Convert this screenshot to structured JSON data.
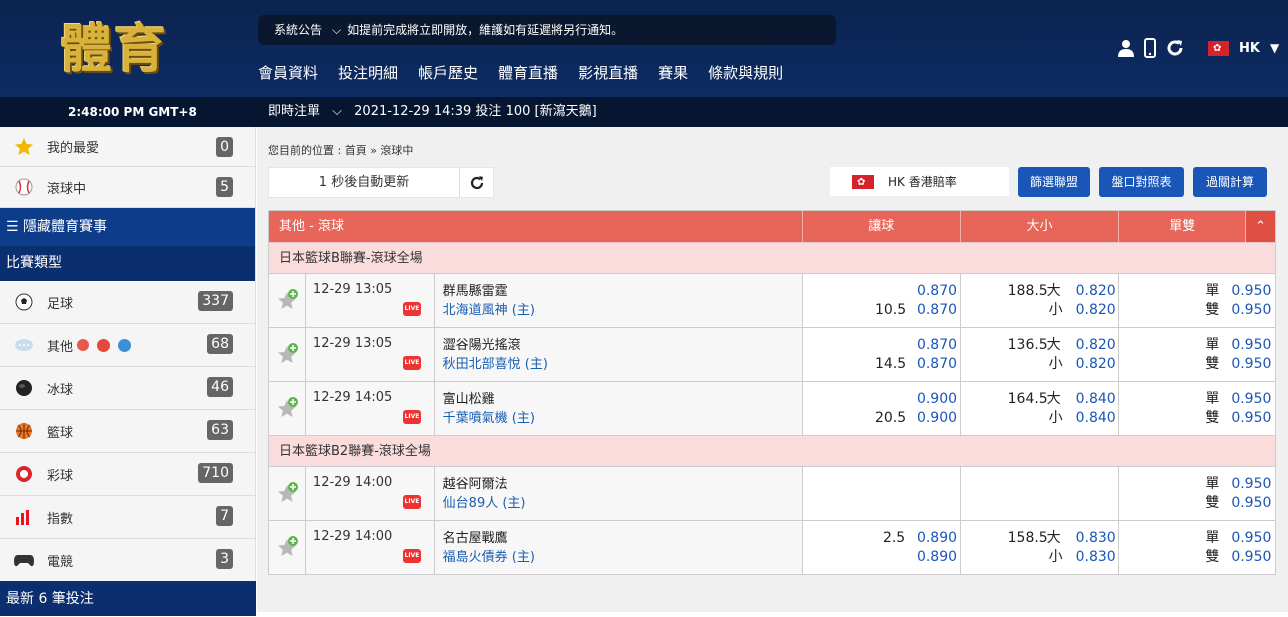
{
  "header": {
    "logo": "體育",
    "notice_label": "系統公告",
    "notice_text": "如提前完成將立即開放，維護如有延遲將另行通知。",
    "nav": [
      "會員資料",
      "投注明細",
      "帳戶歷史",
      "體育直播",
      "影視直播",
      "賽果",
      "條款與規則"
    ],
    "lang": "HK"
  },
  "subbar": {
    "clock": "2:48:00 PM GMT+8",
    "instant_label": "即時注單",
    "instant_text": "2021-12-29 14:39 投注 100 [新瀉天鵝]"
  },
  "sidebar": {
    "fav_label": "我的最愛",
    "fav_count": "0",
    "live_label": "滾球中",
    "live_count": "5",
    "hide_label": "隱藏體育賽事",
    "types_label": "比賽類型",
    "sports": [
      {
        "label": "足球",
        "count": "337"
      },
      {
        "label": "其他",
        "count": "68"
      },
      {
        "label": "冰球",
        "count": "46"
      },
      {
        "label": "籃球",
        "count": "63"
      },
      {
        "label": "彩球",
        "count": "710"
      },
      {
        "label": "指數",
        "count": "7"
      },
      {
        "label": "電競",
        "count": "3"
      }
    ],
    "recent_label": "最新 6 筆投注"
  },
  "main": {
    "breadcrumb": "您目前的位置 : 首頁 » 滾球中",
    "refresh_text": "1 秒後自動更新",
    "odds_format": "HK  香港賠率",
    "buttons": [
      "篩選聯盟",
      "盤口對照表",
      "過關計算"
    ]
  },
  "table": {
    "headers": {
      "title": "其他 - 滾球",
      "hc": "讓球",
      "ou": "大小",
      "oe": "單雙"
    },
    "leagues": [
      {
        "name": "日本籃球B聯賽-滾球全場"
      },
      {
        "name": "日本籃球B2聯賽-滾球全場"
      }
    ],
    "matches": [
      {
        "time": "12-29 13:05",
        "home": "群馬縣雷霆",
        "away": "北海道風神 (主)",
        "hc_line": "10.5",
        "hc1": "0.870",
        "hc2": "0.870",
        "ou_line": "188.5",
        "big": "大",
        "small": "小",
        "ou1": "0.820",
        "ou2": "0.820",
        "odd_lbl": "單",
        "even_lbl": "雙",
        "oe1": "0.950",
        "oe2": "0.950"
      },
      {
        "time": "12-29 13:05",
        "home": "澀谷陽光搖滾",
        "away": "秋田北部喜悅 (主)",
        "hc_line": "14.5",
        "hc1": "0.870",
        "hc2": "0.870",
        "ou_line": "136.5",
        "big": "大",
        "small": "小",
        "ou1": "0.820",
        "ou2": "0.820",
        "odd_lbl": "單",
        "even_lbl": "雙",
        "oe1": "0.950",
        "oe2": "0.950"
      },
      {
        "time": "12-29 14:05",
        "home": "富山松雞",
        "away": "千葉噴氣機 (主)",
        "hc_line": "20.5",
        "hc1": "0.900",
        "hc2": "0.900",
        "ou_line": "164.5",
        "big": "大",
        "small": "小",
        "ou1": "0.840",
        "ou2": "0.840",
        "odd_lbl": "單",
        "even_lbl": "雙",
        "oe1": "0.950",
        "oe2": "0.950"
      },
      {
        "time": "12-29 14:00",
        "home": "越谷阿爾法",
        "away": "仙台89人 (主)",
        "odd_lbl": "單",
        "even_lbl": "雙",
        "oe1": "0.950",
        "oe2": "0.950"
      },
      {
        "time": "12-29 14:00",
        "home": "名古屋戰鷹",
        "away": "福島火債券 (主)",
        "hc_line": "2.5",
        "hc1": "0.890",
        "hc2": "0.890",
        "ou_line": "158.5",
        "big": "大",
        "small": "小",
        "ou1": "0.830",
        "ou2": "0.830",
        "odd_lbl": "單",
        "even_lbl": "雙",
        "oe1": "0.950",
        "oe2": "0.950"
      }
    ],
    "live_tag": "LIVE"
  }
}
